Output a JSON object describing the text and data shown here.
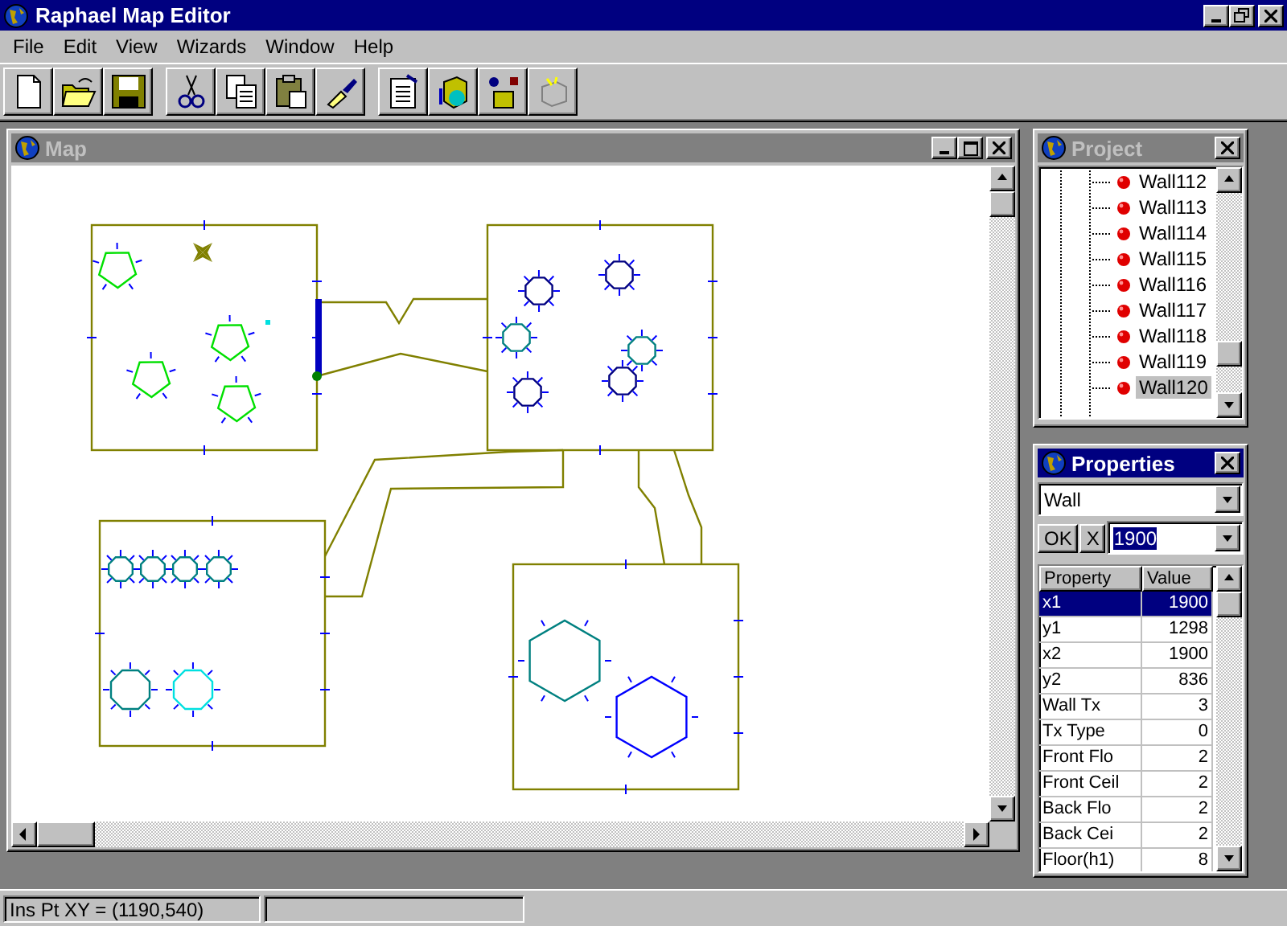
{
  "window": {
    "title": "Raphael Map Editor"
  },
  "menu": [
    {
      "label": "File"
    },
    {
      "label": "Edit"
    },
    {
      "label": "View"
    },
    {
      "label": "Wizards"
    },
    {
      "label": "Window"
    },
    {
      "label": "Help"
    }
  ],
  "map_window": {
    "title": "Map"
  },
  "project_panel": {
    "title": "Project",
    "items": [
      {
        "label": "Wall112",
        "selected": false
      },
      {
        "label": "Wall113",
        "selected": false
      },
      {
        "label": "Wall114",
        "selected": false
      },
      {
        "label": "Wall115",
        "selected": false
      },
      {
        "label": "Wall116",
        "selected": false
      },
      {
        "label": "Wall117",
        "selected": false
      },
      {
        "label": "Wall118",
        "selected": false
      },
      {
        "label": "Wall119",
        "selected": false
      },
      {
        "label": "Wall120",
        "selected": true
      }
    ]
  },
  "properties_panel": {
    "title": "Properties",
    "object_type": "Wall",
    "ok_label": "OK",
    "cancel_label": "X",
    "edit_value": "1900",
    "columns": [
      "Property",
      "Value"
    ],
    "rows": [
      {
        "property": "x1",
        "value": "1900",
        "selected": true
      },
      {
        "property": "y1",
        "value": "1298",
        "selected": false
      },
      {
        "property": "x2",
        "value": "1900",
        "selected": false
      },
      {
        "property": "y2",
        "value": "836",
        "selected": false
      },
      {
        "property": "Wall Tx",
        "value": "3",
        "selected": false
      },
      {
        "property": "Tx Type",
        "value": "0",
        "selected": false
      },
      {
        "property": "Front Flo",
        "value": "2",
        "selected": false
      },
      {
        "property": "Front Ceil",
        "value": "2",
        "selected": false
      },
      {
        "property": "Back Flo",
        "value": "2",
        "selected": false
      },
      {
        "property": "Back Cei",
        "value": "2",
        "selected": false
      },
      {
        "property": "Floor(h1)",
        "value": "8",
        "selected": false
      }
    ]
  },
  "status_bar": [
    "Ins Pt XY = (1190,540)"
  ]
}
